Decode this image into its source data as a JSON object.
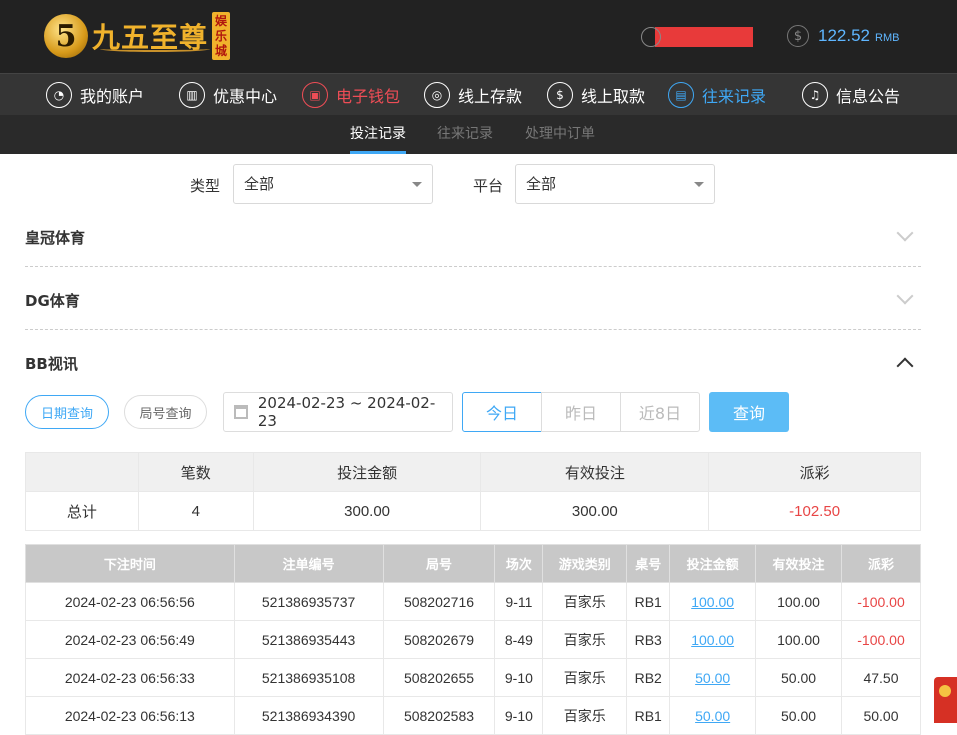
{
  "header": {
    "logo_text": "九五至尊",
    "logo_badge": "娱乐城",
    "balance": "122.52",
    "balance_unit": "RMB"
  },
  "nav": [
    {
      "label": "我的账户",
      "icon": "user-icon"
    },
    {
      "label": "优惠中心",
      "icon": "gift-icon"
    },
    {
      "label": "电子钱包",
      "icon": "wallet-icon"
    },
    {
      "label": "线上存款",
      "icon": "deposit-icon"
    },
    {
      "label": "线上取款",
      "icon": "withdraw-icon"
    },
    {
      "label": "往来记录",
      "icon": "records-icon"
    },
    {
      "label": "信息公告",
      "icon": "bell-icon"
    }
  ],
  "subnav": [
    "投注记录",
    "往来记录",
    "处理中订单"
  ],
  "filters": {
    "type_label": "类型",
    "type_value": "全部",
    "platform_label": "平台",
    "platform_value": "全部"
  },
  "sections": [
    "皇冠体育",
    "DG体育",
    "BB视讯"
  ],
  "query": {
    "date_query": "日期查询",
    "round_query": "局号查询",
    "date_range": "2024-02-23 ~ 2024-02-23",
    "today": "今日",
    "yesterday": "昨日",
    "last8": "近8日",
    "submit": "查询"
  },
  "summary": {
    "headers": [
      "",
      "笔数",
      "投注金额",
      "有效投注",
      "派彩"
    ],
    "row": [
      "总计",
      "4",
      "300.00",
      "300.00",
      "-102.50"
    ]
  },
  "detail": {
    "headers": [
      "下注时间",
      "注单编号",
      "局号",
      "场次",
      "游戏类别",
      "桌号",
      "投注金额",
      "有效投注",
      "派彩"
    ],
    "rows": [
      [
        "2024-02-23 06:56:56",
        "521386935737",
        "508202716",
        "9-11",
        "百家乐",
        "RB1",
        "100.00",
        "100.00",
        "-100.00"
      ],
      [
        "2024-02-23 06:56:49",
        "521386935443",
        "508202679",
        "8-49",
        "百家乐",
        "RB3",
        "100.00",
        "100.00",
        "-100.00"
      ],
      [
        "2024-02-23 06:56:33",
        "521386935108",
        "508202655",
        "9-10",
        "百家乐",
        "RB2",
        "50.00",
        "50.00",
        "47.50"
      ],
      [
        "2024-02-23 06:56:13",
        "521386934390",
        "508202583",
        "9-10",
        "百家乐",
        "RB1",
        "50.00",
        "50.00",
        "50.00"
      ]
    ]
  }
}
